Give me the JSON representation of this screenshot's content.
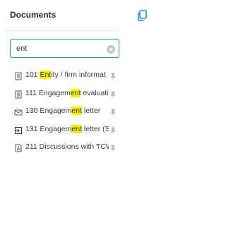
{
  "panel": {
    "title": "Documents",
    "copy_icon": "copy-icon"
  },
  "search": {
    "value": "ent",
    "clear_icon": "clear-circle-icon"
  },
  "documents": [
    {
      "icon": "document-icon",
      "before": "101 ",
      "match": "Ent",
      "after": "ity / firm informat",
      "pin_icon": "pin-icon"
    },
    {
      "icon": "document-icon",
      "before": "111 Engagem",
      "match": "ent",
      "after": " evaluati",
      "pin_icon": "pin-icon"
    },
    {
      "icon": "envelope-icon",
      "before": "130 Engagem",
      "match": "ent",
      "after": " letter",
      "pin_icon": "pin-icon"
    },
    {
      "icon": "signin-icon",
      "before": "131 Engagem",
      "match": "ent",
      "after": " letter (S",
      "pin_icon": "pin-icon"
    },
    {
      "icon": "pdf-icon",
      "before": "211 Discussions with TCW",
      "match": "",
      "after": "",
      "pin_icon": "pin-icon"
    }
  ],
  "colors": {
    "accent": "#1c8fd6",
    "highlight": "#f4f00a"
  }
}
